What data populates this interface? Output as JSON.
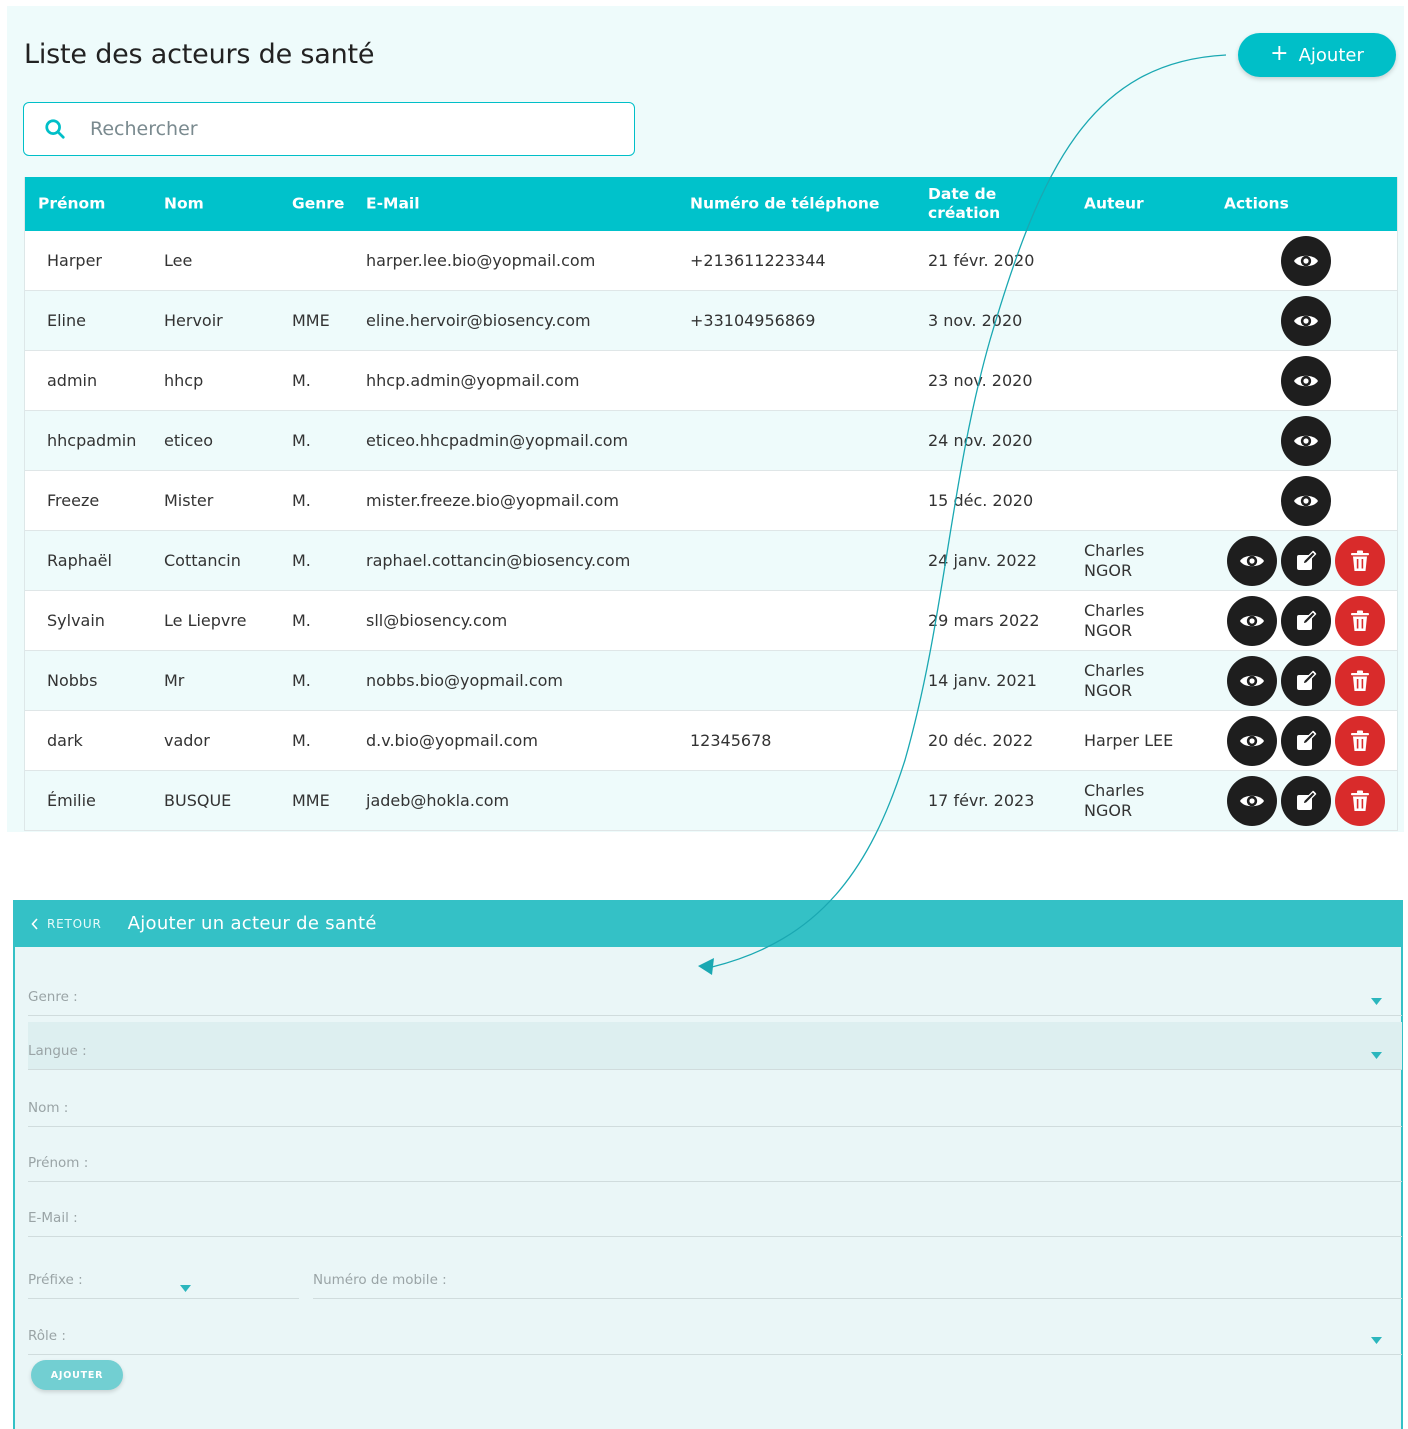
{
  "list": {
    "title": "Liste des acteurs de santé",
    "add_label": "Ajouter",
    "search_placeholder": "Rechercher",
    "columns": {
      "prenom": "Prénom",
      "nom": "Nom",
      "genre": "Genre",
      "email": "E-Mail",
      "telephone": "Numéro de téléphone",
      "date": "Date de création",
      "auteur": "Auteur",
      "actions": "Actions"
    },
    "rows": [
      {
        "prenom": "Harper",
        "nom": "Lee",
        "genre": "",
        "email": "harper.lee.bio@yopmail.com",
        "telephone": "+213611223344",
        "date": "21 févr. 2020",
        "auteur": "",
        "actions": [
          "view"
        ]
      },
      {
        "prenom": "Eline",
        "nom": "Hervoir",
        "genre": "MME",
        "email": "eline.hervoir@biosency.com",
        "telephone": "+33104956869",
        "date": "3 nov. 2020",
        "auteur": "",
        "actions": [
          "view"
        ]
      },
      {
        "prenom": "admin",
        "nom": "hhcp",
        "genre": "M.",
        "email": "hhcp.admin@yopmail.com",
        "telephone": "",
        "date": "23 nov. 2020",
        "auteur": "",
        "actions": [
          "view"
        ]
      },
      {
        "prenom": "hhcpadmin",
        "nom": "eticeo",
        "genre": "M.",
        "email": "eticeo.hhcpadmin@yopmail.com",
        "telephone": "",
        "date": "24 nov. 2020",
        "auteur": "",
        "actions": [
          "view"
        ]
      },
      {
        "prenom": "Freeze",
        "nom": "Mister",
        "genre": "M.",
        "email": "mister.freeze.bio@yopmail.com",
        "telephone": "",
        "date": "15 déc. 2020",
        "auteur": "",
        "actions": [
          "view"
        ]
      },
      {
        "prenom": "Raphaël",
        "nom": "Cottancin",
        "genre": "M.",
        "email": "raphael.cottancin@biosency.com",
        "telephone": "",
        "date": "24 janv. 2022",
        "auteur": "Charles NGOR",
        "actions": [
          "view",
          "edit",
          "delete"
        ]
      },
      {
        "prenom": "Sylvain",
        "nom": "Le Liepvre",
        "genre": "M.",
        "email": "sll@biosency.com",
        "telephone": "",
        "date": "29 mars 2022",
        "auteur": "Charles NGOR",
        "actions": [
          "view",
          "edit",
          "delete"
        ]
      },
      {
        "prenom": "Nobbs",
        "nom": "Mr",
        "genre": "M.",
        "email": "nobbs.bio@yopmail.com",
        "telephone": "",
        "date": "14 janv. 2021",
        "auteur": "Charles NGOR",
        "actions": [
          "view",
          "edit",
          "delete"
        ]
      },
      {
        "prenom": "dark",
        "nom": "vador",
        "genre": "M.",
        "email": "d.v.bio@yopmail.com",
        "telephone": "12345678",
        "date": "20 déc. 2022",
        "auteur": "Harper LEE",
        "actions": [
          "view",
          "edit",
          "delete"
        ]
      },
      {
        "prenom": "Émilie",
        "nom": "BUSQUE",
        "genre": "MME",
        "email": "jadeb@hokla.com",
        "telephone": "",
        "date": "17 févr. 2023",
        "auteur": "Charles NGOR",
        "actions": [
          "view",
          "edit",
          "delete"
        ]
      }
    ]
  },
  "form": {
    "back_label": "RETOUR",
    "title": "Ajouter un acteur de santé",
    "fields": {
      "genre": "Genre :",
      "langue": "Langue :",
      "nom": "Nom :",
      "prenom": "Prénom :",
      "email": "E-Mail :",
      "prefixe": "Préfixe :",
      "mobile": "Numéro de mobile :",
      "role": "Rôle :"
    },
    "submit_label": "AJOUTER"
  },
  "colors": {
    "accent": "#00bfc8",
    "header_bg": "#00c2cb",
    "form_header": "#34c1c6",
    "delete": "#d92b2b",
    "action_dark": "#1e1e1e"
  }
}
